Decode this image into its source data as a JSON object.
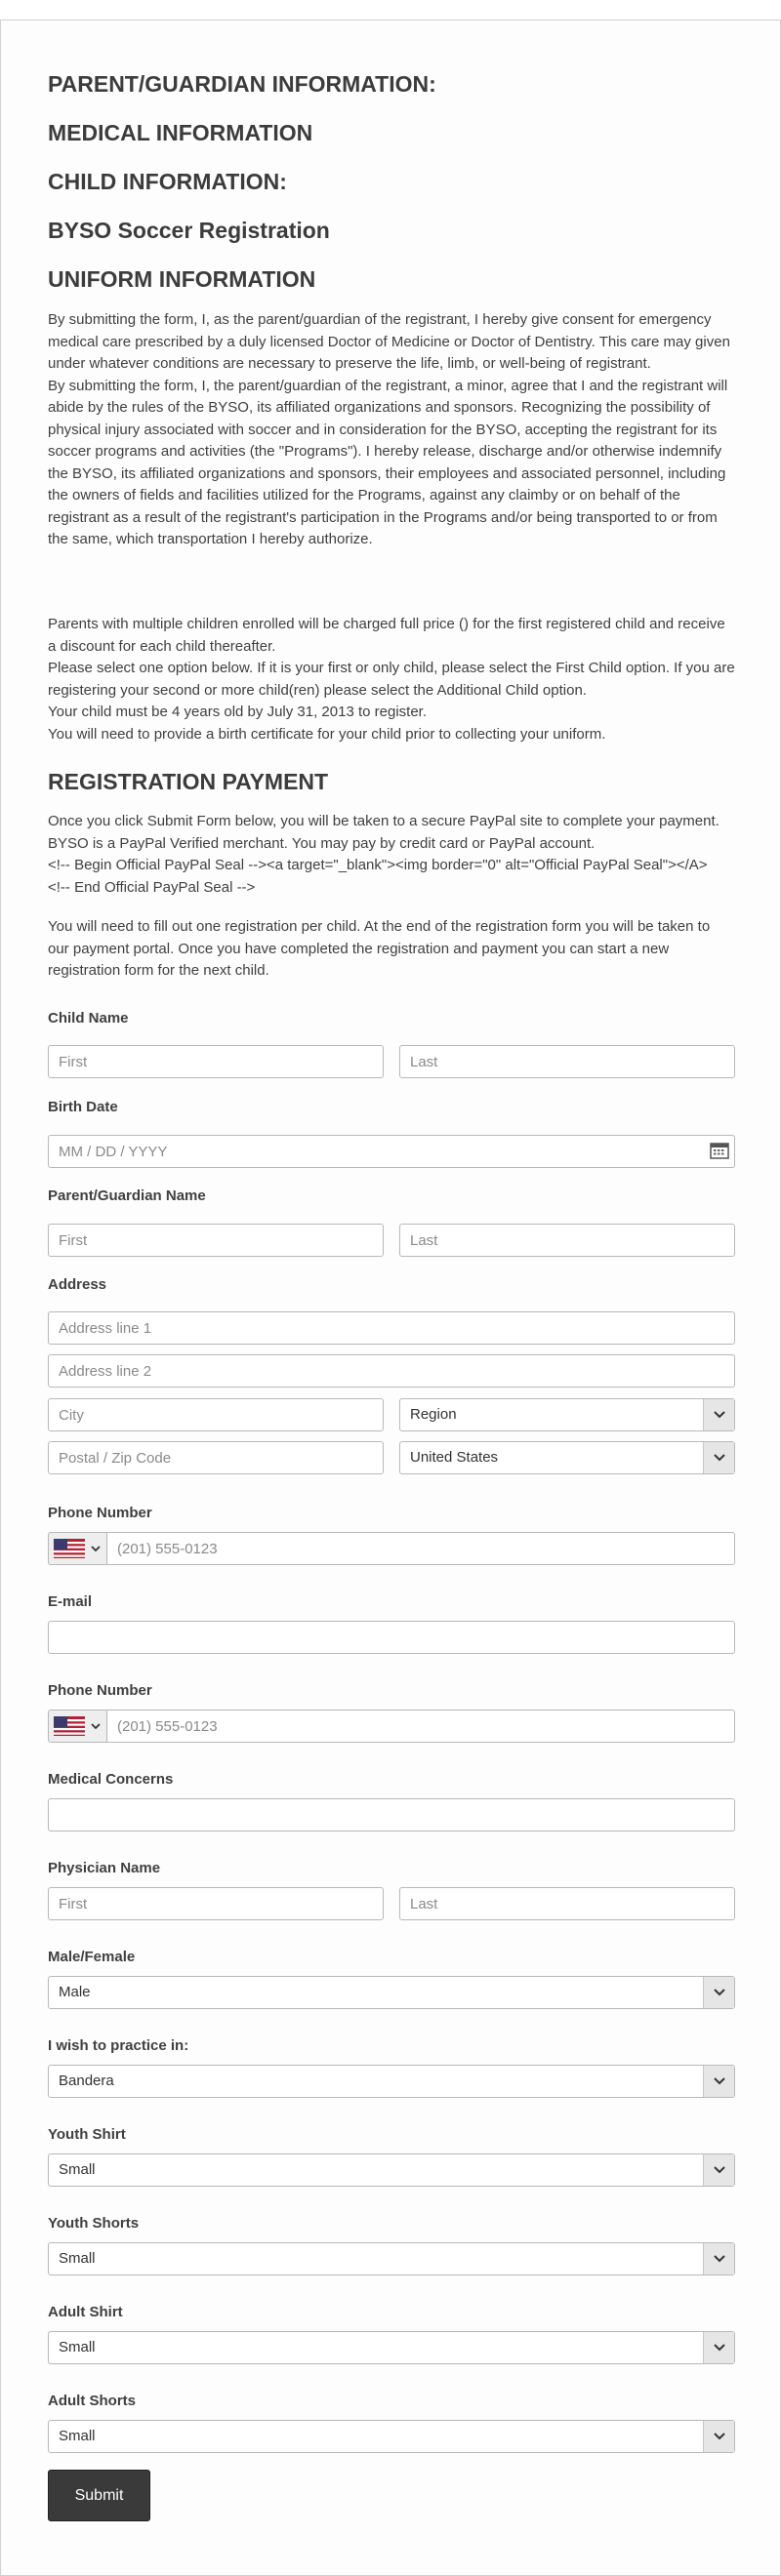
{
  "headings": {
    "parent_info": "PARENT/GUARDIAN INFORMATION:",
    "medical_info": "MEDICAL INFORMATION",
    "child_info": "CHILD INFORMATION:",
    "form_title": "BYSO Soccer Registration",
    "uniform_info": "UNIFORM INFORMATION",
    "registration_payment": "REGISTRATION PAYMENT"
  },
  "consent": {
    "medical": "By submitting the form, I, as the parent/guardian of the registrant, I hereby give consent for emergency medical care prescribed by a duly licensed Doctor of Medicine or Doctor of Dentistry. This care may given under whatever conditions are necessary to preserve the life, limb, or well-being of registrant.",
    "liability": "By submitting the form, I, the parent/guardian of the registrant, a minor, agree that I and the registrant will abide by the rules of the BYSO, its affiliated organizations and sponsors. Recognizing the possibility of physical injury associated with soccer and in consideration for the BYSO, accepting the registrant for its soccer programs and activities (the \"Programs\"). I hereby release, discharge and/or otherwise indemnify the BYSO, its affiliated organizations and sponsors, their employees and associated personnel, including the owners of fields and facilities utilized for the Programs, against any claimby or on behalf of the registrant as a result of the registrant's participation in the Programs and/or being transported to or from the same, which transportation I hereby authorize."
  },
  "info_lines": [
    "Parents with multiple children enrolled will be charged full price () for the first registered child and receive a discount for each child thereafter.",
    "Please select one option below. If it is your first or only child, please select the First Child option. If you are registering your second or more child(ren) please select the Additional Child option.",
    "Your child must be 4 years old by July 31, 2013 to register.",
    "You will need to provide a birth certificate for your child prior to collecting your uniform."
  ],
  "payment_lines": [
    "Once you click Submit Form below, you will be taken to a secure PayPal site to complete your payment. BYSO is a PayPal Verified merchant. You may pay by credit card or PayPal account.",
    "<!-- Begin Official PayPal Seal --><a target=\"_blank\"><img border=\"0\" alt=\"Official PayPal Seal\"></A>",
    "<!-- End Official PayPal Seal -->"
  ],
  "one_registration_note": "You will need to fill out one registration per child. At the end of the registration form you will be taken to our payment portal. Once you have completed the registration and payment you can start a new registration form for the next child.",
  "fields": {
    "child_name": {
      "label": "Child Name",
      "first_placeholder": "First",
      "last_placeholder": "Last"
    },
    "birth_date": {
      "label": "Birth Date",
      "placeholder": "MM / DD / YYYY"
    },
    "parent_name": {
      "label": "Parent/Guardian Name",
      "first_placeholder": "First",
      "last_placeholder": "Last"
    },
    "address": {
      "label": "Address",
      "line1_placeholder": "Address line 1",
      "line2_placeholder": "Address line 2",
      "city_placeholder": "City",
      "region_value": "Region",
      "postal_placeholder": "Postal / Zip Code",
      "country_value": "United States"
    },
    "phone1": {
      "label": "Phone Number",
      "placeholder": "(201) 555-0123"
    },
    "email": {
      "label": "E-mail",
      "value": ""
    },
    "phone2": {
      "label": "Phone Number",
      "placeholder": "(201) 555-0123"
    },
    "medical_concerns": {
      "label": "Medical Concerns",
      "value": ""
    },
    "physician_name": {
      "label": "Physician Name",
      "first_placeholder": "First",
      "last_placeholder": "Last"
    },
    "gender": {
      "label": "Male/Female",
      "value": "Male"
    },
    "practice_location": {
      "label": "I wish to practice in:",
      "value": "Bandera"
    },
    "youth_shirt": {
      "label": "Youth Shirt",
      "value": "Small"
    },
    "youth_shorts": {
      "label": "Youth Shorts",
      "value": "Small"
    },
    "adult_shirt": {
      "label": "Adult Shirt",
      "value": "Small"
    },
    "adult_shorts": {
      "label": "Adult Shorts",
      "value": "Small"
    }
  },
  "submit_label": "Submit",
  "icons": {
    "calendar": "calendar-icon",
    "chevron": "chevron-down-icon",
    "flag": "us-flag-icon"
  }
}
